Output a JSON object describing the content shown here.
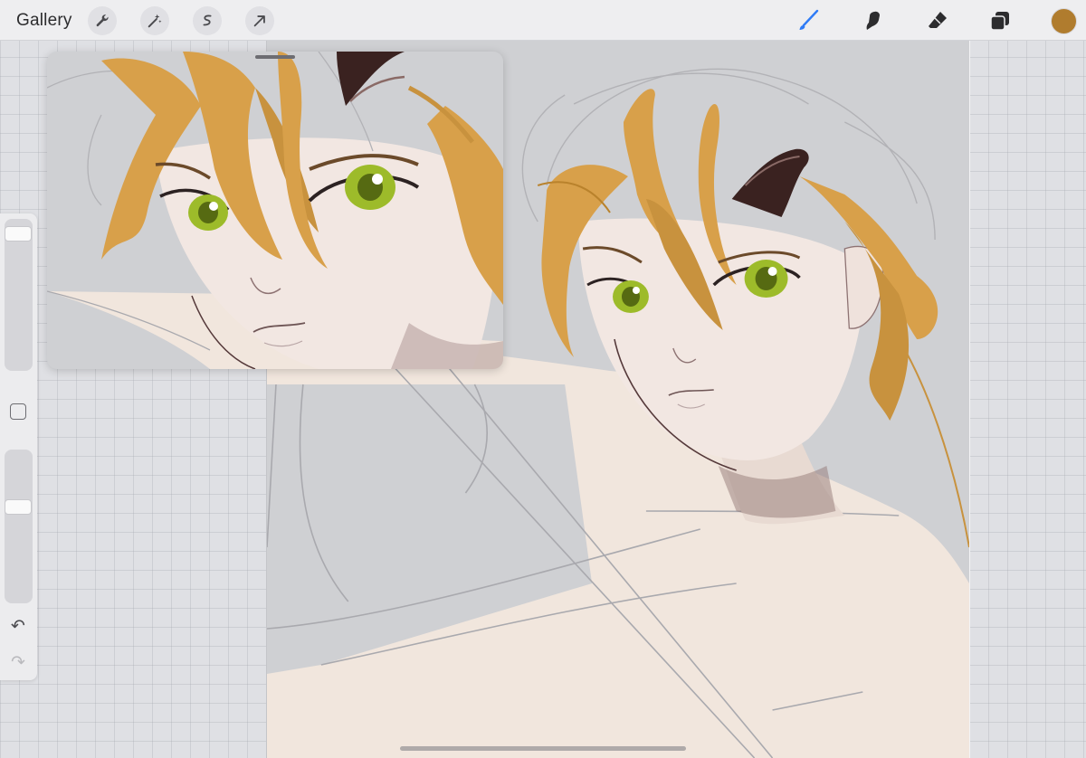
{
  "toolbar": {
    "gallery_label": "Gallery",
    "left_tools": [
      {
        "name": "wrench-icon"
      },
      {
        "name": "magic-wand-icon"
      },
      {
        "name": "selection-icon"
      },
      {
        "name": "transform-arrow-icon"
      }
    ],
    "right_tools": [
      {
        "name": "brush-icon",
        "active": true
      },
      {
        "name": "smudge-icon"
      },
      {
        "name": "eraser-icon"
      },
      {
        "name": "layers-icon"
      }
    ],
    "current_color": "#b07c2e",
    "accent_color": "#2f7bf6"
  },
  "sidebar": {
    "brush_size_level": 0.05,
    "opacity_level": 0.36,
    "modify_button": "square-modify-icon",
    "undo": "undo-icon",
    "redo": "redo-icon"
  },
  "palette": {
    "hair": "#d8a04a",
    "hair_dark": "#b9822c",
    "skin": "#f1e6dd",
    "horn": "#3a2220",
    "eye": "#9dbb2a",
    "sketch": "#a9a9ae"
  }
}
